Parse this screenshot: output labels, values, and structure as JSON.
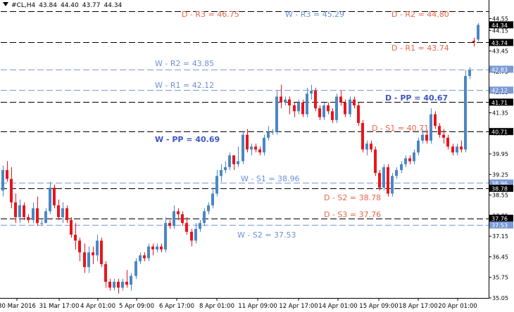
{
  "header": {
    "symbol": "#CL,H4",
    "open": "43.84",
    "high": "44.40",
    "low": "43.77",
    "close": "44.34"
  },
  "colors": {
    "bull": "#4a86c5",
    "bear": "#e8151b",
    "daily_line": "#000000",
    "weekly_line": "#7b9ad4",
    "daily_text": "#e8654a",
    "weekly_text": "#6f8fd8",
    "pp_text": "#3d55c6"
  },
  "chart_data": {
    "type": "candlestick",
    "ylim": [
      35.05,
      44.85
    ],
    "y_ticks": [
      "44.55",
      "44.15",
      "43.45",
      "42.75",
      "42.05",
      "41.35",
      "40.65",
      "39.95",
      "39.25",
      "38.55",
      "37.85",
      "37.15",
      "36.45",
      "35.75",
      "35.05"
    ],
    "x_ticks": [
      "30 Mar 2016",
      "31 Mar 17:00",
      "4 Apr 01:00",
      "5 Apr 09:00",
      "6 Apr 17:00",
      "8 Apr 01:00",
      "11 Apr 09:00",
      "12 Apr 17:00",
      "14 Apr 01:00",
      "15 Apr 09:00",
      "18 Apr 17:00",
      "20 Apr 01:00"
    ],
    "current_price": "44.34",
    "levels": [
      {
        "label": "D - R3 = 46.75",
        "price": 46.75,
        "kind": "daily",
        "tag": ""
      },
      {
        "label": "W - R3 = 45.29",
        "price": 45.29,
        "kind": "weekly",
        "tag": ""
      },
      {
        "label": "D - R2 = 44.80",
        "price": 44.8,
        "kind": "daily",
        "tag": ""
      },
      {
        "label": "D - R1 = 43.74",
        "price": 43.74,
        "kind": "daily",
        "tag": "43.74"
      },
      {
        "label": "W - R2 = 43.85",
        "price": 42.83,
        "kind": "weekly",
        "tag": "42.83"
      },
      {
        "label": "W - R1 = 42.12",
        "price": 42.12,
        "kind": "weekly",
        "tag": "42.12"
      },
      {
        "label": "D - PP = 40.67",
        "price": 41.71,
        "kind": "daily",
        "tag": "41.71"
      },
      {
        "label": "W - PP = 40.69",
        "price": 40.71,
        "kind": "daily",
        "tag": "40.71"
      },
      {
        "label": "D - S1 = 40.71",
        "price": 40.71,
        "kind": "daily",
        "tag": ""
      },
      {
        "label": "W - S1 = 38.96",
        "price": 38.96,
        "kind": "weekly",
        "tag": "38.96"
      },
      {
        "label": "D - S2 = 38.78",
        "price": 38.78,
        "kind": "daily",
        "tag": "38.78"
      },
      {
        "label": "D - S3 = 37.76",
        "price": 37.76,
        "kind": "daily",
        "tag": "37.76"
      },
      {
        "label": "W - S2 = 37.53",
        "price": 37.53,
        "kind": "weekly",
        "tag": "37.53"
      }
    ],
    "candles": [
      [
        38.7,
        39.55,
        38.5,
        39.4
      ],
      [
        39.4,
        39.7,
        39.0,
        39.1
      ],
      [
        39.1,
        39.5,
        38.1,
        38.3
      ],
      [
        38.3,
        38.6,
        37.6,
        37.8
      ],
      [
        37.8,
        38.4,
        37.6,
        38.2
      ],
      [
        38.2,
        38.3,
        37.7,
        37.8
      ],
      [
        37.8,
        37.9,
        37.6,
        37.7
      ],
      [
        37.7,
        38.3,
        37.6,
        38.1
      ],
      [
        38.1,
        38.5,
        37.5,
        37.6
      ],
      [
        37.6,
        37.7,
        37.5,
        37.6
      ],
      [
        37.6,
        38.1,
        37.6,
        38.0
      ],
      [
        38.0,
        39.0,
        37.9,
        38.8
      ],
      [
        38.8,
        38.9,
        38.1,
        38.2
      ],
      [
        38.2,
        38.4,
        37.7,
        37.8
      ],
      [
        37.8,
        38.3,
        37.6,
        38.1
      ],
      [
        38.1,
        38.2,
        37.6,
        37.7
      ],
      [
        37.7,
        37.8,
        37.1,
        37.2
      ],
      [
        37.2,
        37.6,
        36.7,
        37.0
      ],
      [
        37.0,
        37.1,
        36.3,
        36.6
      ],
      [
        36.6,
        36.9,
        35.9,
        36.1
      ],
      [
        36.1,
        36.8,
        35.9,
        36.6
      ],
      [
        36.6,
        36.8,
        36.2,
        36.5
      ],
      [
        36.5,
        37.2,
        36.3,
        37.0
      ],
      [
        37.0,
        37.1,
        36.1,
        36.2
      ],
      [
        36.2,
        36.3,
        35.4,
        35.6
      ],
      [
        35.6,
        35.7,
        35.3,
        35.4
      ],
      [
        35.4,
        35.7,
        35.3,
        35.6
      ],
      [
        35.6,
        35.7,
        35.2,
        35.4
      ],
      [
        35.4,
        35.7,
        35.3,
        35.6
      ],
      [
        35.6,
        36.0,
        35.4,
        35.5
      ],
      [
        35.5,
        35.9,
        35.3,
        35.8
      ],
      [
        35.8,
        36.4,
        35.7,
        36.3
      ],
      [
        36.3,
        36.6,
        36.2,
        36.5
      ],
      [
        36.5,
        36.6,
        36.3,
        36.4
      ],
      [
        36.4,
        36.9,
        36.3,
        36.8
      ],
      [
        36.8,
        36.9,
        36.5,
        36.7
      ],
      [
        36.7,
        36.9,
        36.6,
        36.8
      ],
      [
        36.8,
        36.9,
        36.6,
        36.7
      ],
      [
        36.7,
        37.8,
        36.6,
        37.6
      ],
      [
        37.6,
        37.7,
        37.4,
        37.5
      ],
      [
        37.5,
        38.2,
        37.4,
        38.0
      ],
      [
        38.0,
        38.1,
        37.7,
        37.9
      ],
      [
        37.9,
        38.0,
        37.5,
        37.6
      ],
      [
        37.6,
        37.8,
        37.2,
        37.3
      ],
      [
        37.3,
        37.4,
        36.8,
        37.0
      ],
      [
        37.0,
        37.6,
        36.9,
        37.4
      ],
      [
        37.4,
        37.7,
        37.3,
        37.6
      ],
      [
        37.6,
        38.1,
        37.5,
        38.0
      ],
      [
        38.0,
        38.3,
        37.9,
        38.2
      ],
      [
        38.2,
        38.8,
        38.1,
        38.6
      ],
      [
        38.6,
        39.4,
        38.5,
        39.2
      ],
      [
        39.2,
        39.6,
        39.0,
        39.4
      ],
      [
        39.4,
        39.7,
        39.3,
        39.5
      ],
      [
        39.5,
        40.0,
        39.4,
        39.9
      ],
      [
        39.9,
        39.9,
        39.4,
        39.6
      ],
      [
        39.6,
        40.2,
        39.5,
        39.7
      ],
      [
        39.7,
        40.7,
        39.6,
        40.6
      ],
      [
        40.6,
        40.8,
        40.0,
        40.1
      ],
      [
        40.1,
        40.3,
        39.9,
        40.2
      ],
      [
        40.2,
        40.3,
        40.0,
        40.1
      ],
      [
        40.1,
        40.2,
        39.9,
        40.0
      ],
      [
        40.0,
        40.6,
        39.9,
        40.5
      ],
      [
        40.5,
        40.9,
        40.4,
        40.7
      ],
      [
        40.7,
        40.8,
        40.6,
        40.7
      ],
      [
        40.7,
        42.1,
        40.6,
        41.9
      ],
      [
        41.9,
        42.3,
        41.5,
        41.7
      ],
      [
        41.7,
        41.9,
        41.6,
        41.8
      ],
      [
        41.8,
        41.9,
        41.3,
        41.6
      ],
      [
        41.6,
        41.7,
        41.2,
        41.4
      ],
      [
        41.4,
        41.8,
        41.3,
        41.7
      ],
      [
        41.7,
        41.8,
        41.2,
        41.3
      ],
      [
        41.3,
        42.2,
        41.2,
        42.0
      ],
      [
        42.0,
        42.3,
        41.8,
        42.1
      ],
      [
        42.1,
        42.2,
        41.4,
        41.5
      ],
      [
        41.5,
        41.6,
        41.1,
        41.2
      ],
      [
        41.2,
        41.7,
        41.1,
        41.6
      ],
      [
        41.6,
        41.7,
        41.3,
        41.4
      ],
      [
        41.4,
        41.5,
        41.0,
        41.1
      ],
      [
        41.1,
        42.0,
        41.0,
        41.9
      ],
      [
        41.9,
        42.1,
        41.6,
        41.7
      ],
      [
        41.7,
        41.8,
        41.2,
        41.3
      ],
      [
        41.3,
        41.9,
        41.2,
        41.8
      ],
      [
        41.8,
        41.9,
        41.5,
        41.6
      ],
      [
        41.6,
        41.7,
        40.9,
        41.0
      ],
      [
        41.0,
        41.1,
        40.0,
        40.1
      ],
      [
        40.1,
        40.4,
        39.9,
        40.3
      ],
      [
        40.3,
        40.4,
        40.0,
        40.1
      ],
      [
        40.1,
        40.2,
        39.2,
        39.3
      ],
      [
        39.3,
        39.4,
        38.7,
        38.8
      ],
      [
        38.8,
        39.6,
        38.7,
        39.5
      ],
      [
        39.5,
        39.6,
        38.5,
        38.6
      ],
      [
        38.6,
        39.3,
        38.5,
        39.2
      ],
      [
        39.2,
        39.5,
        39.1,
        39.4
      ],
      [
        39.4,
        39.7,
        39.3,
        39.6
      ],
      [
        39.6,
        39.9,
        39.5,
        39.8
      ],
      [
        39.8,
        39.9,
        39.6,
        39.7
      ],
      [
        39.7,
        40.1,
        39.6,
        40.0
      ],
      [
        40.0,
        40.5,
        39.9,
        40.4
      ],
      [
        40.4,
        40.8,
        40.3,
        40.6
      ],
      [
        40.6,
        40.7,
        40.3,
        40.4
      ],
      [
        40.4,
        41.5,
        40.3,
        41.3
      ],
      [
        41.3,
        41.4,
        40.8,
        40.9
      ],
      [
        40.9,
        41.0,
        40.5,
        40.6
      ],
      [
        40.6,
        40.8,
        40.3,
        40.5
      ],
      [
        40.5,
        40.6,
        40.1,
        40.2
      ],
      [
        40.2,
        40.3,
        39.9,
        40.0
      ],
      [
        40.0,
        40.3,
        39.9,
        40.2
      ],
      [
        40.2,
        40.4,
        40.0,
        40.1
      ],
      [
        40.1,
        42.8,
        40.0,
        42.6
      ],
      [
        42.6,
        42.9,
        42.5,
        42.8
      ],
      [
        43.8,
        43.9,
        43.6,
        43.75
      ],
      [
        43.84,
        44.4,
        43.77,
        44.34
      ]
    ]
  }
}
